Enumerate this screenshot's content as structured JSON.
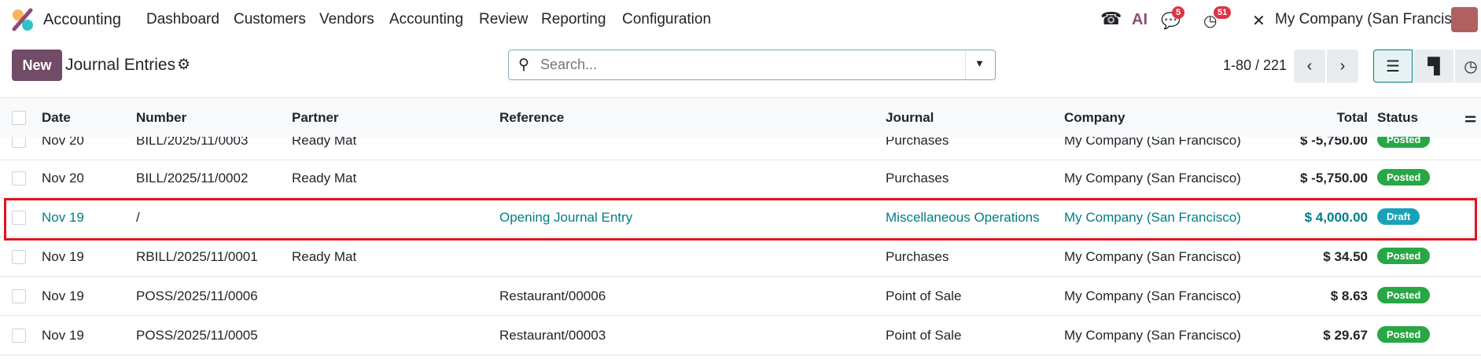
{
  "nav": {
    "app_name": "Accounting",
    "menu": [
      "Dashboard",
      "Customers",
      "Vendors",
      "Accounting",
      "Review",
      "Reporting",
      "Configuration"
    ],
    "chat_badge": "5",
    "activity_badge": "51",
    "company": "My Company (San Francisco)",
    "ai_label": "AI"
  },
  "control": {
    "new_label": "New",
    "title": "Journal Entries",
    "search_placeholder": "Search...",
    "pager": "1-80 / 221"
  },
  "columns": [
    "Date",
    "Number",
    "Partner",
    "Reference",
    "Journal",
    "Company",
    "Total",
    "Status"
  ],
  "rows": [
    {
      "date": "Nov 20",
      "number": "BILL/2025/11/0003",
      "partner": "Ready Mat",
      "reference": "",
      "journal": "Purchases",
      "company": "My Company (San Francisco)",
      "total": "$ -5,750.00",
      "status": "Posted"
    },
    {
      "date": "Nov 20",
      "number": "BILL/2025/11/0002",
      "partner": "Ready Mat",
      "reference": "",
      "journal": "Purchases",
      "company": "My Company (San Francisco)",
      "total": "$ -5,750.00",
      "status": "Posted"
    },
    {
      "date": "Nov 19",
      "number": "/",
      "partner": "",
      "reference": "Opening Journal Entry",
      "journal": "Miscellaneous Operations",
      "company": "My Company (San Francisco)",
      "total": "$ 4,000.00",
      "status": "Draft"
    },
    {
      "date": "Nov 19",
      "number": "RBILL/2025/11/0001",
      "partner": "Ready Mat",
      "reference": "",
      "journal": "Purchases",
      "company": "My Company (San Francisco)",
      "total": "$ 34.50",
      "status": "Posted"
    },
    {
      "date": "Nov 19",
      "number": "POSS/2025/11/0006",
      "partner": "",
      "reference": "Restaurant/00006",
      "journal": "Point of Sale",
      "company": "My Company (San Francisco)",
      "total": "$ 8.63",
      "status": "Posted"
    },
    {
      "date": "Nov 19",
      "number": "POSS/2025/11/0005",
      "partner": "",
      "reference": "Restaurant/00003",
      "journal": "Point of Sale",
      "company": "My Company (San Francisco)",
      "total": "$ 29.67",
      "status": "Posted"
    }
  ],
  "colors": {
    "brand": "#714b67",
    "posted": "#28a745",
    "draft": "#17a2b8",
    "link": "#017e84",
    "highlight": "#e0141e"
  }
}
